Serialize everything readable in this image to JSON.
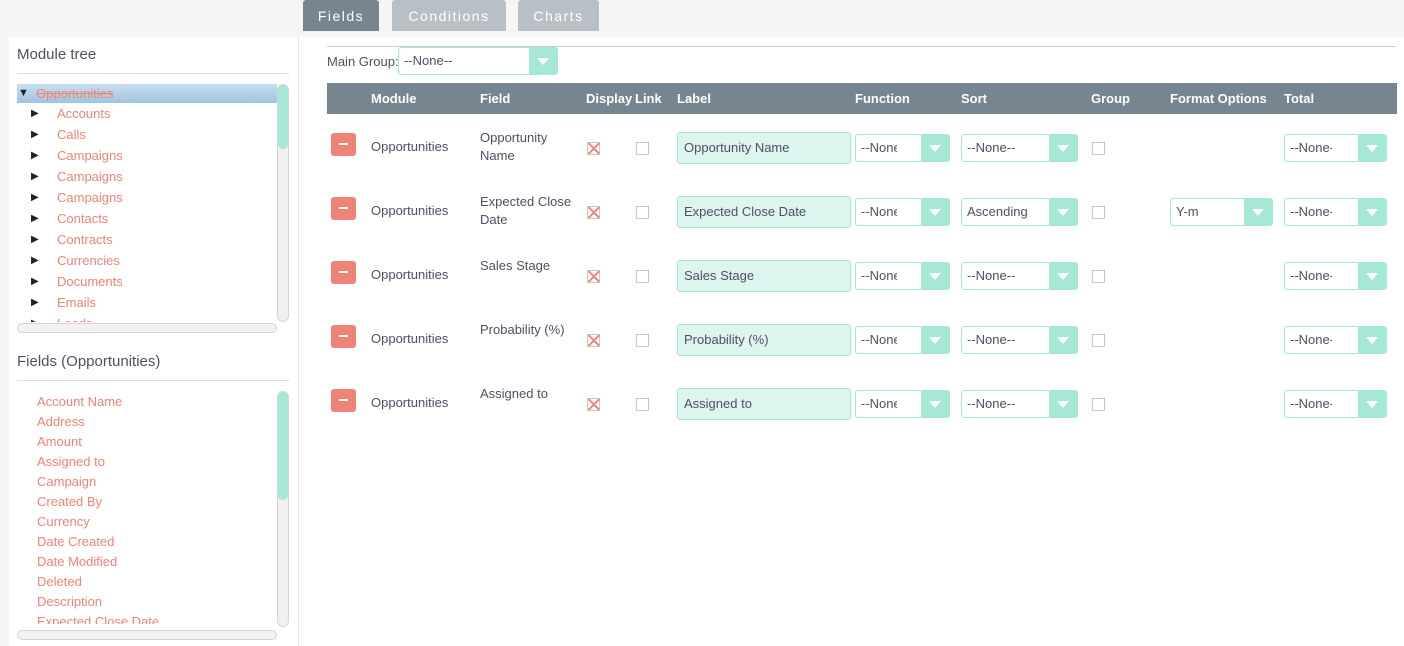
{
  "tabs": [
    "Fields",
    "Conditions",
    "Charts"
  ],
  "left": {
    "module_tree_title": "Module tree",
    "tree_root": "Opportunities",
    "tree_items": [
      "Accounts",
      "Calls",
      "Campaigns",
      "Campaigns",
      "Campaigns",
      "Contacts",
      "Contracts",
      "Currencies",
      "Documents",
      "Emails",
      "Leads"
    ],
    "fields_title": "Fields (Opportunities)",
    "fields": [
      "Account Name",
      "Address",
      "Amount",
      "Assigned to",
      "Campaign",
      "Created By",
      "Currency",
      "Date Created",
      "Date Modified",
      "Deleted",
      "Description",
      "Expected Close Date"
    ]
  },
  "main": {
    "main_group_label": "Main Group:",
    "main_group_value": "--None--",
    "headers": {
      "module": "Module",
      "field": "Field",
      "display": "Display",
      "link": "Link",
      "label": "Label",
      "function": "Function",
      "sort": "Sort",
      "group": "Group",
      "format": "Format Options",
      "total": "Total"
    },
    "rows": [
      {
        "module": "Opportunities",
        "field": "Opportunity Name",
        "display": true,
        "link": false,
        "label": "Opportunity Name",
        "function": "--None--",
        "sort": "--None--",
        "group": false,
        "format": "",
        "total": "--None--"
      },
      {
        "module": "Opportunities",
        "field": "Expected Close Date",
        "display": true,
        "link": false,
        "label": "Expected Close Date",
        "function": "--None--",
        "sort": "Ascending",
        "group": false,
        "format": "Y-m",
        "total": "--None--"
      },
      {
        "module": "Opportunities",
        "field": "Sales Stage",
        "display": true,
        "link": false,
        "label": "Sales Stage",
        "function": "--None--",
        "sort": "--None--",
        "group": false,
        "format": "",
        "total": "--None--"
      },
      {
        "module": "Opportunities",
        "field": "Probability (%)",
        "display": true,
        "link": false,
        "label": "Probability (%)",
        "function": "--None--",
        "sort": "--None--",
        "group": false,
        "format": "",
        "total": "--None--"
      },
      {
        "module": "Opportunities",
        "field": "Assigned to",
        "display": true,
        "link": false,
        "label": "Assigned to",
        "function": "--None--",
        "sort": "--None--",
        "group": false,
        "format": "",
        "total": "--None--"
      }
    ]
  },
  "colors": {
    "accent": "#f08377",
    "teal": "#a5e8d6",
    "header": "#778591"
  },
  "icons": [
    "remove-icon",
    "caret-right-icon",
    "caret-down-icon",
    "chevron-down-icon"
  ]
}
